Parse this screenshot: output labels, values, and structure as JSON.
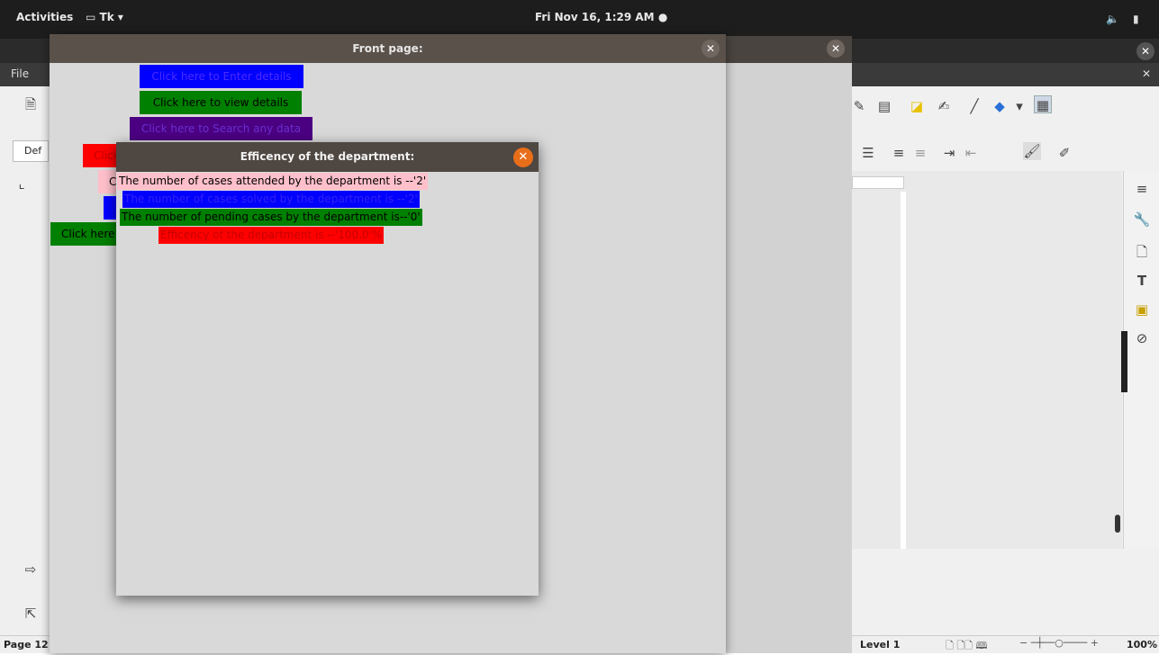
{
  "topbar": {
    "activities": "Activities",
    "app_menu": "Tk",
    "clock": "Fri Nov 16,  1:29 AM"
  },
  "libreoffice": {
    "menu_file": "File",
    "style_box_text": "Def",
    "status_page": "Page 12",
    "status_level": "Level 1",
    "status_zoom": "100%"
  },
  "front_window": {
    "title": "Front page:",
    "buttons": {
      "enter_details": "Click here to Enter details",
      "view_details": "Click here to view details",
      "search_data": "Click here to Search any data",
      "red_partial": "Click",
      "pink_partial": "C",
      "green_partial": "Click here"
    }
  },
  "efficiency_window": {
    "title": "Efficency of the department:",
    "lines": {
      "attended": "The number of cases attended by the department is --'2'",
      "solved": "The number of cases solved by the department is --'2'",
      "pending": "The number of pending cases by the department is--'0'",
      "efficiency": "Efficency of the department is --'100.0'%"
    }
  },
  "colors": {
    "blue": "#0000ff",
    "green": "#008000",
    "purple": "#4b0082",
    "red": "#ff0000",
    "pink": "#ffc0cb",
    "titlebar_orange": "#e96e1a"
  }
}
